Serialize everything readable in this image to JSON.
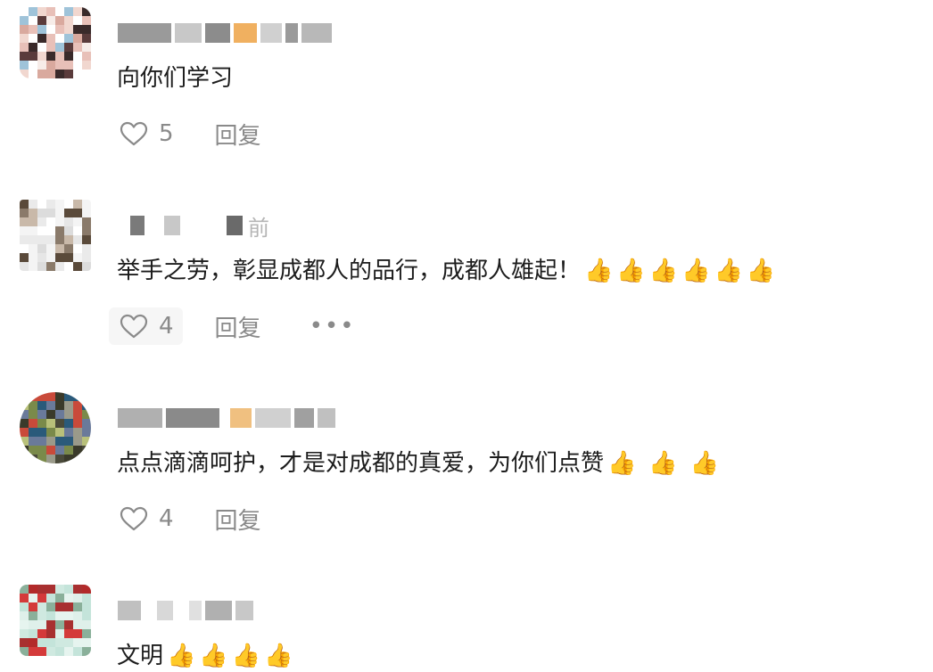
{
  "comments": [
    {
      "name_suffix": "",
      "text": "向你们学习",
      "thumbs": [],
      "likes": "5",
      "reply_label": "回复",
      "show_more": false
    },
    {
      "name_suffix": "前",
      "text": "举手之劳，彰显成都人的品行，成都人雄起！",
      "thumbs": [
        "👍",
        "👍",
        "👍",
        "👍",
        "👍",
        "👍"
      ],
      "likes": "4",
      "reply_label": "回复",
      "show_more": true,
      "more_label": "•••"
    },
    {
      "name_suffix": "",
      "text": "点点滴滴呵护，才是对成都的真爱，为你们点赞",
      "thumbs": [
        "👍",
        "👍",
        "👍"
      ],
      "likes": "4",
      "reply_label": "回复",
      "show_more": false
    },
    {
      "name_suffix": "",
      "text": "文明",
      "thumbs": [
        "👍",
        "👍",
        "👍",
        "👍"
      ]
    }
  ],
  "colors": {
    "text": "#1c1c1c",
    "meta": "#8a8a8a",
    "blurred_name": "#b5b5b5",
    "highlight": "#f6f6f6"
  },
  "icons": {
    "like": "heart-outline-icon",
    "more": "more-dots-icon",
    "emoji": "thumbs-up-emoji"
  }
}
